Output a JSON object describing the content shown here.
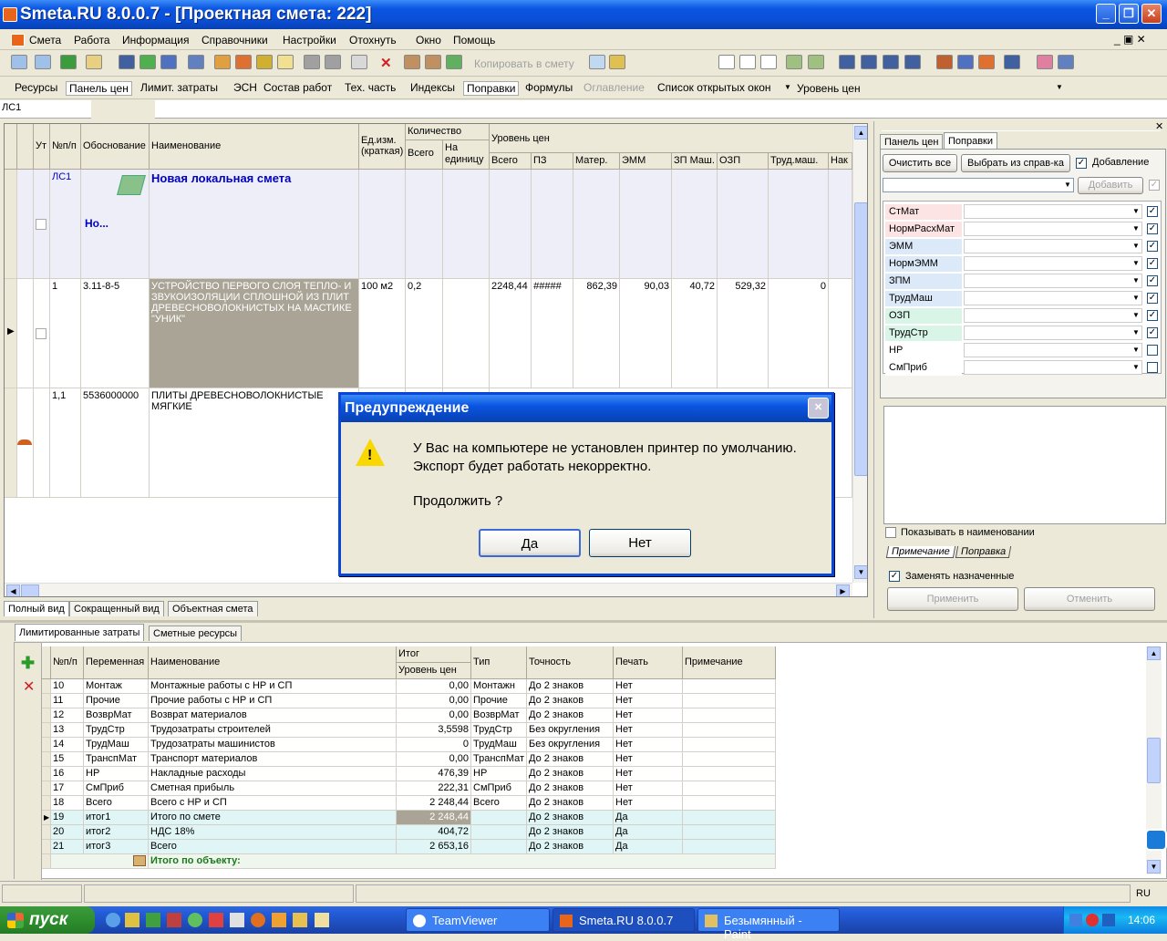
{
  "window": {
    "title": "Smeta.RU  8.0.0.7   - [Проектная смета: 222]"
  },
  "menu": [
    "Смета",
    "Работа",
    "Информация",
    "Справочники",
    "Настройки",
    "Отохнуть",
    "Окно",
    "Помощь"
  ],
  "toolbar": {
    "copy_label": "Копировать в смету"
  },
  "panels": [
    "Ресурсы",
    "Панель цен",
    "Лимит. затраты",
    "ЭСН",
    "Состав работ",
    "Тех. часть",
    "Индексы",
    "Поправки",
    "Формулы",
    "Оглавление",
    "Список открытых окон"
  ],
  "price_level_combo": "Уровень цен",
  "address": "ЛС1",
  "grid": {
    "headers": {
      "ut": "Ут",
      "num": "№п/п",
      "basis": "Обоснование",
      "name": "Наименование",
      "unit": "Ед.изм. (краткая)",
      "qty": "Количество",
      "qty_total": "Всего",
      "qty_per": "На единицу",
      "level": "Уровень цен",
      "total": "Всего",
      "pz": "ПЗ",
      "mat": "Матер.",
      "emm": "ЭММ",
      "zpm": "ЗП Маш.",
      "ozp": "ОЗП",
      "trudm": "Труд.маш.",
      "nak": "Нак"
    },
    "group": {
      "code": "ЛС1",
      "title": "Новая локальная смета",
      "sub": "Но..."
    },
    "row1": {
      "num": "1",
      "basis": "3.11-8-5",
      "name": "УСТРОЙСТВО ПЕРВОГО СЛОЯ ТЕПЛО- И ЗВУКОИЗОЛЯЦИИ СПЛОШНОЙ ИЗ ПЛИТ ДРЕВЕСНОВОЛОКНИСТЫХ НА МАСТИКЕ \"УНИК\"",
      "unit": "100 м2",
      "qty": "0,2",
      "total": "2248,44",
      "pz": "#####",
      "mat": "862,39",
      "emm": "90,03",
      "zpm": "40,72",
      "ozp": "529,32",
      "trudm": "0"
    },
    "row2": {
      "num": "1,1",
      "basis": "5536000000",
      "name": "ПЛИТЫ ДРЕВЕСНОВОЛОКНИСТЫЕ МЯГКИЕ"
    }
  },
  "view_tabs": [
    "Полный вид",
    "Сокращенный вид",
    "Объектная смета"
  ],
  "right_panel": {
    "tabs": [
      "Панель цен",
      "Поправки"
    ],
    "clear_all": "Очистить все",
    "choose": "Выбрать из справ-ка",
    "addition": "Добавление",
    "add": "Добавить",
    "items": [
      {
        "label": "СтМат",
        "checked": true,
        "color": "#fde4e4"
      },
      {
        "label": "НормРасхМат",
        "checked": true,
        "color": "#fde4e4"
      },
      {
        "label": "ЭММ",
        "checked": true,
        "color": "#dce9f8"
      },
      {
        "label": "НормЭММ",
        "checked": true,
        "color": "#dce9f8"
      },
      {
        "label": "ЗПМ",
        "checked": true,
        "color": "#dce9f8"
      },
      {
        "label": "ТрудМаш",
        "checked": true,
        "color": "#dce9f8"
      },
      {
        "label": "ОЗП",
        "checked": true,
        "color": "#d9f5e7"
      },
      {
        "label": "ТрудСтр",
        "checked": true,
        "color": "#d9f5e7"
      },
      {
        "label": "НР",
        "checked": false,
        "color": "#ffffff"
      },
      {
        "label": "СмПриб",
        "checked": false,
        "color": "#ffffff"
      }
    ],
    "show_in_name": "Показывать в наименовании",
    "bottom_tabs": [
      "Примечание",
      "Поправка"
    ],
    "replace": "Заменять назначенные",
    "apply": "Применить",
    "cancel": "Отменить"
  },
  "bottom_tabs": [
    "Лимитированные затраты",
    "Сметные ресурсы"
  ],
  "limits": {
    "headers": {
      "num": "№п/п",
      "var": "Переменная",
      "name": "Наименование",
      "itog": "Итог",
      "level": "Уровень цен",
      "type": "Тип",
      "prec": "Точность",
      "print": "Печать",
      "note": "Примечание"
    },
    "rows": [
      [
        "10",
        "Монтаж",
        "Монтажные работы с НР и СП",
        "0,00",
        "Монтажн",
        "До 2 знаков",
        "Нет"
      ],
      [
        "11",
        "Прочие",
        "Прочие работы с НР и СП",
        "0,00",
        "Прочие",
        "До 2 знаков",
        "Нет"
      ],
      [
        "12",
        "ВозврМат",
        "Возврат материалов",
        "0,00",
        "ВозврМат",
        "До 2 знаков",
        "Нет"
      ],
      [
        "13",
        "ТрудСтр",
        "Трудозатраты строителей",
        "3,5598",
        "ТрудСтр",
        "Без округления",
        "Нет"
      ],
      [
        "14",
        "ТрудМаш",
        "Трудозатраты машинистов",
        "0",
        "ТрудМаш",
        "Без округления",
        "Нет"
      ],
      [
        "15",
        "ТранспМат",
        "Транспорт материалов",
        "0,00",
        "ТранспМат",
        "До 2 знаков",
        "Нет"
      ],
      [
        "16",
        "НР",
        "Накладные расходы",
        "476,39",
        "НР",
        "До 2 знаков",
        "Нет"
      ],
      [
        "17",
        "СмПриб",
        "Сметная прибыль",
        "222,31",
        "СмПриб",
        "До 2 знаков",
        "Нет"
      ],
      [
        "18",
        "Всего",
        "Всего с НР и СП",
        "2 248,44",
        "Всего",
        "До 2 знаков",
        "Нет"
      ],
      [
        "19",
        "итог1",
        "Итого по смете",
        "2 248,44",
        "",
        "До 2 знаков",
        "Да"
      ],
      [
        "20",
        "итог2",
        "НДС 18%",
        "404,72",
        "",
        "До 2 знаков",
        "Да"
      ],
      [
        "21",
        "итог3",
        "Всего",
        "2 653,16",
        "",
        "До 2 знаков",
        "Да"
      ]
    ],
    "footer": "Итого по объекту:"
  },
  "status": {
    "lang": "RU"
  },
  "dialog": {
    "title": "Предупреждение",
    "line1": "У Вас на компьютере не установлен принтер по умолчанию.",
    "line2": "Экспорт будет работать некорректно.",
    "question": "Продолжить ?",
    "yes": "Да",
    "no": "Нет"
  },
  "taskbar": {
    "start": "пуск",
    "tasks": [
      "TeamViewer",
      "Smeta.RU  8.0.0.7",
      "Безымянный - Paint"
    ],
    "clock": "14:06"
  }
}
